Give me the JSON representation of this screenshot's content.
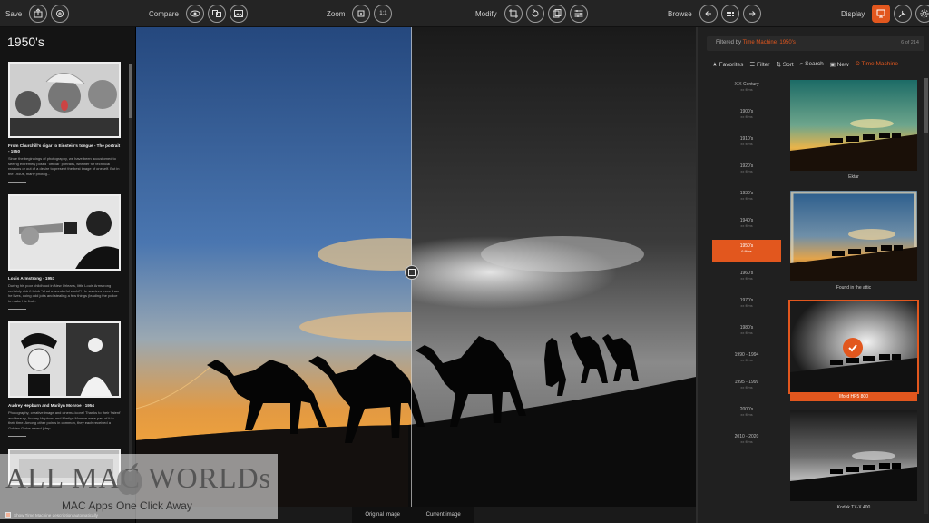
{
  "toolbar": {
    "save_label": "Save",
    "compare_label": "Compare",
    "zoom_label": "Zoom",
    "zoom_value": "1:1",
    "modify_label": "Modify",
    "browse_label": "Browse",
    "display_label": "Display",
    "accent_color": "#e2571e"
  },
  "left_panel": {
    "title": "1950's",
    "stories": [
      {
        "caption": "From Churchill's cigar to Einstein's tongue - The portrait - 1950",
        "body": "Since the beginnings of photography, we have been accustomed to seeing extremely posed \"official\" portraits, whether for technical reasons or out of a desire to present the best image of oneself. But in the 1950s, many photog..."
      },
      {
        "caption": "Louis Armstrong - 1953",
        "body": "During his poor childhood in New Orleans, little Louis Armstrong certainly didn't think \"what a wonderful world\"! He survives more than he lives, doing odd jobs and stealing a few things (leading the police to make his first..."
      },
      {
        "caption": "Audrey Hepburn and Marilyn Monroe - 1954",
        "body": "Photography, creative image and cinema icons! Thanks to their 'talent' and beauty, Audrey Hepburn and Marilyn Monroe were part of it in their time. Among other points in common, they each received a Golden Globe award (Hep..."
      }
    ],
    "bottom_checkbox_label": "Show Time Machine description automatically"
  },
  "main": {
    "original_label": "Original image",
    "current_label": "Current image"
  },
  "right_panel": {
    "filter_prefix": "Filtered by",
    "filter_value": "Time Machine: 1950's",
    "count": "6 of 214",
    "tools": {
      "favorites": "Favorites",
      "filter": "Filter",
      "sort": "Sort",
      "search": "Search",
      "new": "New",
      "time_machine": "Time Machine"
    },
    "decades": [
      {
        "name": "XIX Century",
        "count": "xx films"
      },
      {
        "name": "1900's",
        "count": "xx films"
      },
      {
        "name": "1910's",
        "count": "xx films"
      },
      {
        "name": "1920's",
        "count": "xx films"
      },
      {
        "name": "1930's",
        "count": "xx films"
      },
      {
        "name": "1940's",
        "count": "xx films"
      },
      {
        "name": "1950's",
        "count": "6 films"
      },
      {
        "name": "1960's",
        "count": "xx films"
      },
      {
        "name": "1970's",
        "count": "xx films"
      },
      {
        "name": "1980's",
        "count": "xx films"
      },
      {
        "name": "1990 - 1994",
        "count": "xx films"
      },
      {
        "name": "1995 - 1999",
        "count": "xx films"
      },
      {
        "name": "2000's",
        "count": "xx films"
      },
      {
        "name": "2010 - 2020",
        "count": "xx films"
      }
    ],
    "thumbnails": [
      {
        "name": "Ektar"
      },
      {
        "name": "Found in the attic"
      },
      {
        "name": "Ilford HP5 800"
      },
      {
        "name": "Kodak TX-X 400"
      }
    ]
  },
  "watermark": {
    "title": "ALL MAC WORLDs",
    "subtitle": "MAC Apps One Click Away"
  }
}
